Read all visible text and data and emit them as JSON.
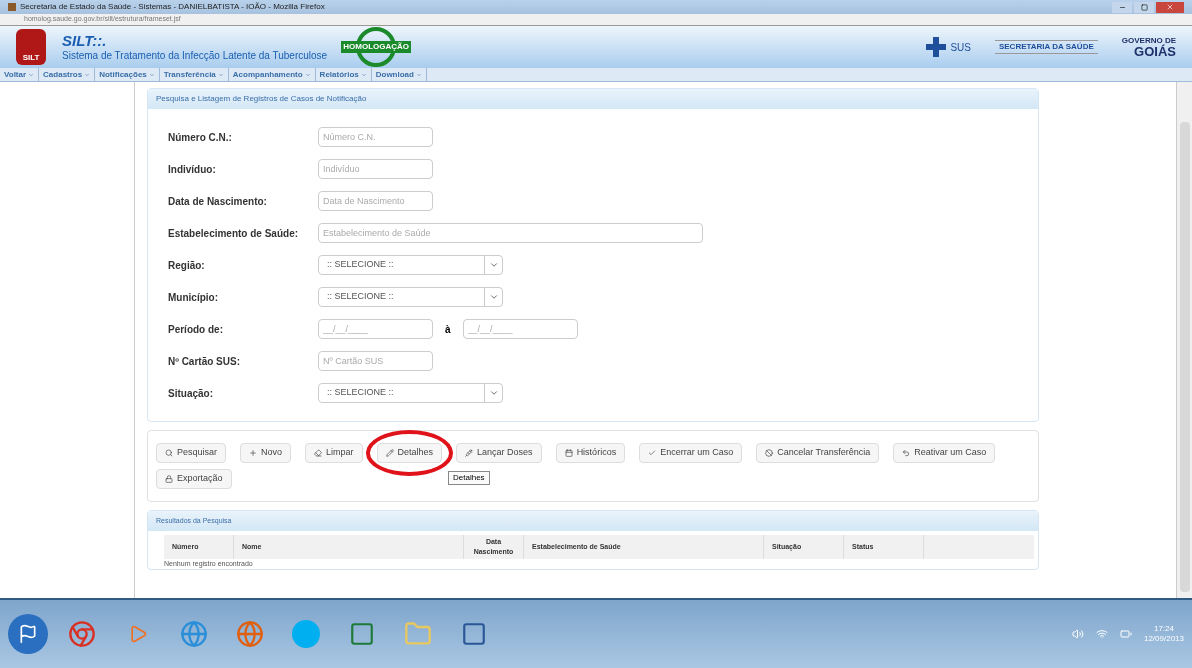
{
  "window": {
    "title": "Secretaria de Estado da Saúde - Sistemas - DANIELBATISTA - IOÃO - Mozilla Firefox"
  },
  "address_bar": {
    "url": "homolog.saude.go.gov.br/silt/estrutura/frameset.jsf"
  },
  "header": {
    "logo_text": "SILT",
    "app_title": "SILT::.",
    "subtitle": "Sistema de Tratamento da Infecção Latente da Tuberculose",
    "stamp": "HOMOLOGAÇÃO",
    "sus": "SUS",
    "secretaria": "SECRETARIA DA SAÚDE",
    "governo_top": "GOVERNO DE",
    "governo": "GOIÁS"
  },
  "menu": [
    "Voltar",
    "Cadastros",
    "Notificações",
    "Transferência",
    "Acompanhamento",
    "Relatórios",
    "Download"
  ],
  "search_panel": {
    "title": "Pesquisa e Listagem de Registros de Casos de Notificação",
    "fields": [
      {
        "kind": "text",
        "label": "Número C.N.:",
        "placeholder": "Número C.N."
      },
      {
        "kind": "text",
        "label": "Indivíduo:",
        "placeholder": "Indivíduo"
      },
      {
        "kind": "text",
        "label": "Data de Nascimento:",
        "placeholder": "Data de Nascimento"
      },
      {
        "kind": "wide",
        "label": "Estabelecimento de Saúde:",
        "placeholder": "Estabelecimento de Saúde"
      },
      {
        "kind": "select",
        "label": "Região:",
        "value": ":: SELECIONE ::"
      },
      {
        "kind": "select",
        "label": "Município:",
        "value": ":: SELECIONE ::"
      },
      {
        "kind": "range",
        "label": "Período de:",
        "placeholder": "__/__/____",
        "separator": "à",
        "placeholder_end": "__/__/____"
      },
      {
        "kind": "text",
        "label": "Nº Cartão SUS:",
        "placeholder": "Nº Cartão SUS"
      },
      {
        "kind": "select",
        "label": "Situação:",
        "value": ":: SELECIONE ::"
      }
    ]
  },
  "toolbar": [
    {
      "label": "Pesquisar",
      "circled": false
    },
    {
      "label": "Novo",
      "circled": false
    },
    {
      "label": "Limpar",
      "circled": false
    },
    {
      "label": "Detalhes",
      "circled": true
    },
    {
      "label": "Lançar Doses",
      "circled": false
    },
    {
      "label": "Históricos",
      "circled": false
    },
    {
      "label": "Encerrar um Caso",
      "circled": false
    },
    {
      "label": "Cancelar Transferência",
      "circled": false
    },
    {
      "label": "Reativar um Caso",
      "circled": false
    },
    {
      "label": "Exportação",
      "circled": false
    }
  ],
  "tooltip": "Detalhes",
  "results": {
    "title": "Resultados da Pesquisa",
    "columns": [
      "Número",
      "Nome",
      "Data Nascimento",
      "Estabelecimento de Saúde",
      "Situação",
      "Status"
    ],
    "empty": "Nenhum registro encontrado"
  },
  "taskbar": {
    "clock_time": "17:24",
    "clock_date": "12/09/2013"
  }
}
